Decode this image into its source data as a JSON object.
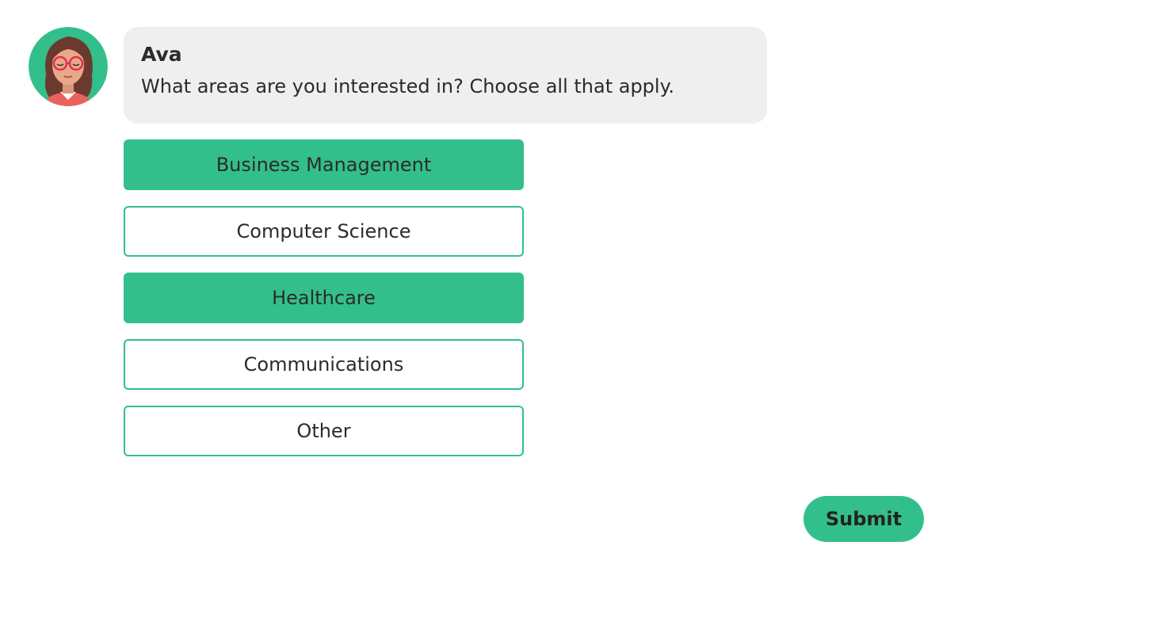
{
  "chat": {
    "sender": "Ava",
    "message": "What areas are you interested in? Choose all that apply."
  },
  "options": [
    {
      "label": "Business Management",
      "selected": true
    },
    {
      "label": "Computer Science",
      "selected": false
    },
    {
      "label": "Healthcare",
      "selected": true
    },
    {
      "label": "Communications",
      "selected": false
    },
    {
      "label": "Other",
      "selected": false
    }
  ],
  "submit_label": "Submit",
  "colors": {
    "accent": "#33bf8c",
    "bubble_bg": "#efefef",
    "text": "#2b2b2b"
  },
  "icons": {
    "avatar": "woman-with-glasses-avatar-icon"
  }
}
